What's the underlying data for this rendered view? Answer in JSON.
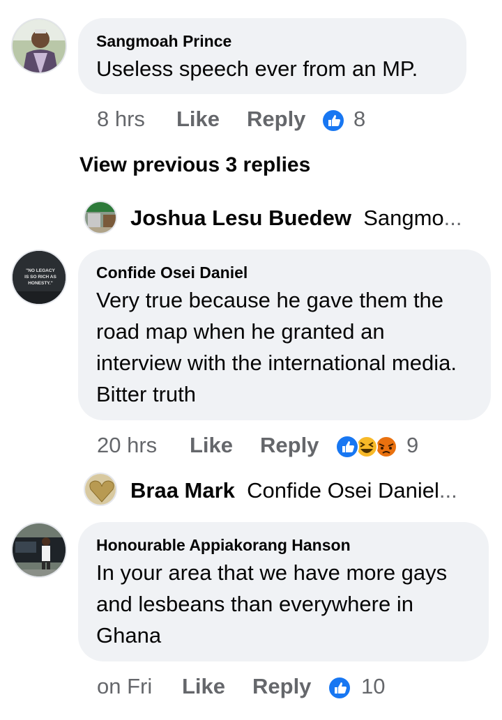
{
  "comments": [
    {
      "author": "Sangmoah Prince",
      "text": "Useless speech ever from an MP.",
      "time": "8 hrs",
      "like_label": "Like",
      "reply_label": "Reply",
      "reaction_count": "8",
      "reactions": [
        "like-icon"
      ]
    },
    {
      "author": "Confide Osei Daniel",
      "avatar_text": "\"NO LEGACY IS SO RICH AS HONESTY.\"",
      "text": "Very true because he gave them the road map when he granted an interview with the international media. Bitter truth",
      "time": "20 hrs",
      "like_label": "Like",
      "reply_label": "Reply",
      "reaction_count": "9",
      "reactions": [
        "like-icon",
        "haha-icon",
        "angry-icon"
      ]
    },
    {
      "author": "Honourable Appiakorang Hanson",
      "text": "In your area that we have more gays and lesbeans than everywhere in Ghana",
      "time": "on Fri",
      "like_label": "Like",
      "reply_label": "Reply",
      "reaction_count": "10",
      "reactions": [
        "like-icon"
      ]
    }
  ],
  "view_previous": "View previous 3 replies",
  "reply_previews": [
    {
      "author": "Joshua Lesu Buedew",
      "snippet": "Sangmo",
      "ellipsis": "..."
    },
    {
      "author": "Braa Mark",
      "snippet": "Confide Osei Daniel",
      "ellipsis": "..."
    }
  ],
  "colors": {
    "bubble": "#f0f2f5",
    "meta_text": "#65676b",
    "text": "#050505",
    "like_blue": "#1877f2",
    "haha_yellow": "#f7b928",
    "angry_orange": "#e9710f"
  }
}
